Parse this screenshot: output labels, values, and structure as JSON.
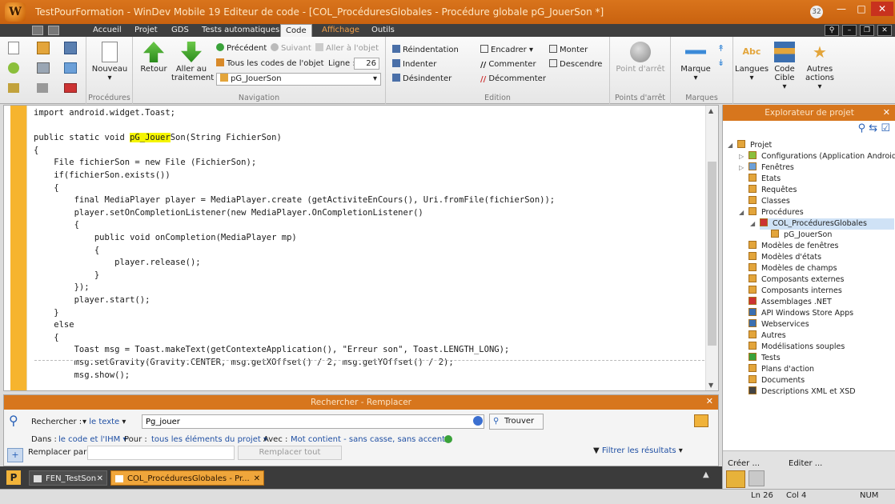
{
  "window": {
    "title": "TestPourFormation - WinDev Mobile 19 Editeur de code - [COL_ProcéduresGlobales - Procédure globale pG_JouerSon *]",
    "badge": "32",
    "logo_text": "W"
  },
  "ribbon_tabs": [
    "Accueil",
    "Projet",
    "GDS",
    "Tests automatiques",
    "Code",
    "Affichage",
    "Outils"
  ],
  "ribbon": {
    "procedures": {
      "nouveau": "Nouveau",
      "group_label": "Procédures"
    },
    "navigation": {
      "retour": "Retour",
      "aller": "Aller au traitement",
      "precedent": "Précédent",
      "suivant": "Suivant",
      "aller_objet": "Aller à l'objet",
      "tous_codes": "Tous les codes de l'objet",
      "ligne_label": "Ligne :",
      "ligne_value": "26",
      "combo_value": "pG_JouerSon",
      "group_label": "Navigation"
    },
    "edition": {
      "reindentation": "Réindentation",
      "indenter": "Indenter",
      "desindenter": "Désindenter",
      "encadrer": "Encadrer",
      "commenter": "Commenter",
      "decommenter": "Décommenter",
      "monter": "Monter",
      "descendre": "Descendre",
      "group_label": "Edition"
    },
    "points_arret": {
      "btn": "Point d'arrêt",
      "group_label": "Points d'arrêt"
    },
    "marques": {
      "btn": "Marque",
      "group_label": "Marques"
    },
    "langues": "Langues",
    "code_cible": "Code Cible",
    "autres_actions": "Autres actions"
  },
  "code_lines": [
    "import android.widget.Toast;",
    "",
    "public static void pG_JouerSon(String FichierSon)",
    "{",
    "    File fichierSon = new File (FichierSon);",
    "    if(fichierSon.exists())",
    "    {",
    "        final MediaPlayer player = MediaPlayer.create (getActiviteEnCours(), Uri.fromFile(fichierSon));",
    "        player.setOnCompletionListener(new MediaPlayer.OnCompletionListener()",
    "        {",
    "            public void onCompletion(MediaPlayer mp)",
    "            {",
    "                player.release();",
    "            }",
    "        });",
    "        player.start();",
    "    }",
    "    else",
    "    {",
    "        Toast msg = Toast.makeText(getContexteApplication(), \"Erreur son\", Toast.LENGTH_LONG);",
    "        msg.setGravity(Gravity.CENTER, msg.getXOffset() / 2, msg.getYOffset() / 2);",
    "        msg.show();"
  ],
  "code_highlight": "pG_Jouer",
  "explorer": {
    "title": "Explorateur de projet",
    "items": [
      "Projet",
      "Configurations (Application Android)",
      "Fenêtres",
      "Etats",
      "Requêtes",
      "Classes",
      "Procédures",
      "COL_ProcéduresGlobales",
      "pG_JouerSon",
      "Modèles de fenêtres",
      "Modèles d'états",
      "Modèles de champs",
      "Composants externes",
      "Composants internes",
      "Assemblages .NET",
      "API Windows Store Apps",
      "Webservices",
      "Autres",
      "Modélisations souples",
      "Tests",
      "Plans d'action",
      "Documents",
      "Descriptions XML et XSD"
    ],
    "creer": "Créer ...",
    "editer": "Editer ..."
  },
  "search": {
    "title": "Rechercher - Remplacer",
    "rechercher_label": "Rechercher :",
    "le_texte": "le texte",
    "query": "Pg_jouer",
    "trouver": "Trouver",
    "dans_label": "Dans :",
    "dans_value": "le code et l'IHM",
    "pour_label": "Pour :",
    "pour_value": "tous les éléments du projet",
    "avec_label": "Avec :",
    "avec_value": "Mot contient - sans casse, sans accent",
    "remplacer_label": "Remplacer par :",
    "remplacer_tout": "Remplacer tout",
    "filtrer": "Filtrer les résultats"
  },
  "taskbar": {
    "tab1": "FEN_TestSon",
    "tab2": "COL_ProcéduresGlobales - Pr..."
  },
  "status": {
    "line": "Ln 26",
    "col": "Col 4",
    "num": "NUM"
  }
}
